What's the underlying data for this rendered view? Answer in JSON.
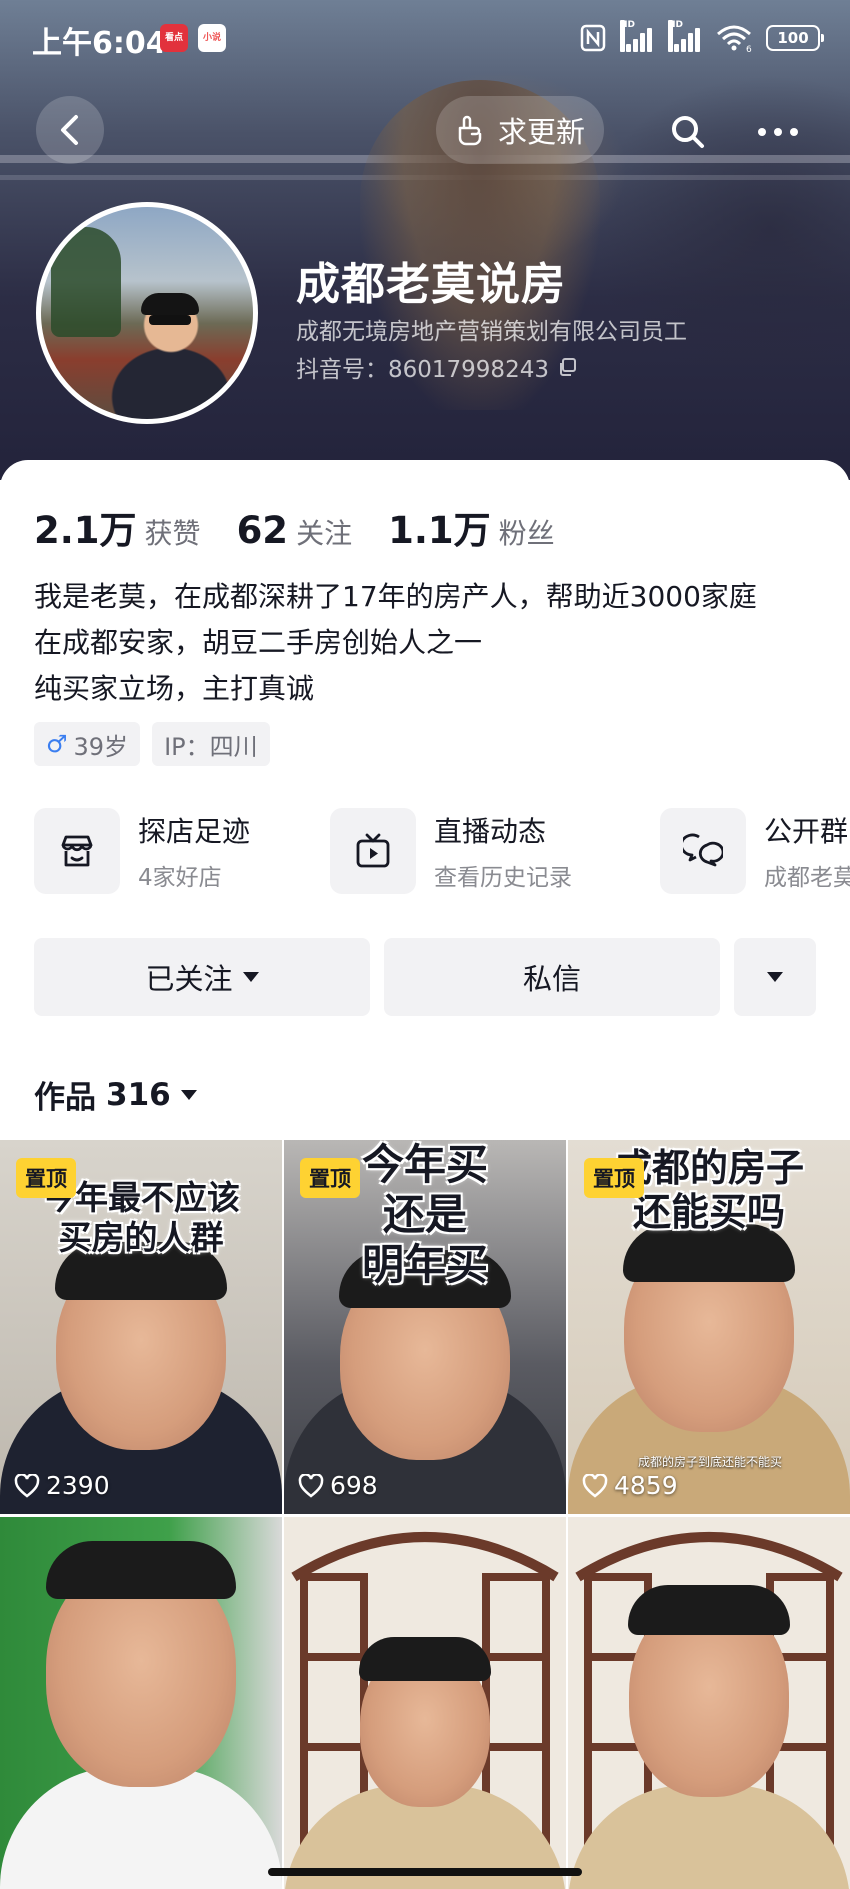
{
  "status_bar": {
    "time": "上午6:04",
    "app_badge_1": "看点",
    "app_badge_2": "小说",
    "network_1": "HD",
    "network_2": "HD",
    "wifi_label": "6",
    "battery": "100"
  },
  "nav": {
    "request_update_label": "求更新"
  },
  "profile": {
    "name": "成都老莫说房",
    "company": "成都无境房地产营销策划有限公司员工",
    "douyin_id": "抖音号：86017998243"
  },
  "stats": [
    {
      "value": "2.1万",
      "label": "获赞"
    },
    {
      "value": "62",
      "label": "关注"
    },
    {
      "value": "1.1万",
      "label": "粉丝"
    }
  ],
  "bio": {
    "line1": "我是老莫，在成都深耕了17年的房产人，帮助近3000家庭",
    "line2": "在成都安家，胡豆二手房创始人之一",
    "line3": "纯买家立场，主打真诚"
  },
  "tags": {
    "age": "39岁",
    "ip": "IP：四川"
  },
  "shortcuts": [
    {
      "title": "探店足迹",
      "subtitle": "4家好店",
      "icon": "shop-icon"
    },
    {
      "title": "直播动态",
      "subtitle": "查看历史记录",
      "icon": "tv-icon"
    },
    {
      "title": "公开群",
      "subtitle": "成都老莫",
      "icon": "chat-icon"
    }
  ],
  "actions": {
    "followed_label": "已关注",
    "message_label": "私信"
  },
  "works": {
    "label": "作品",
    "count": "316"
  },
  "videos": [
    {
      "pinned": "置顶",
      "cover_text": "今年最不应该买房的人群",
      "cover_line1": "今年最不应该",
      "cover_line2": "买房的人群",
      "likes": "2390"
    },
    {
      "pinned": "置顶",
      "cover_line1": "今年买",
      "cover_line2": "还是",
      "cover_line3": "明年买",
      "likes": "698"
    },
    {
      "pinned": "置顶",
      "cover_line1": "成都的房子",
      "cover_line2": "还能买吗",
      "caption": "成都的房子到底还能不能买",
      "likes": "4859"
    },
    {
      "likes": ""
    },
    {
      "likes": ""
    },
    {
      "likes": ""
    }
  ],
  "colors": {
    "pin_badge": "#fed232",
    "text_primary": "#161823",
    "text_secondary": "#6f7079",
    "button_bg": "#f2f2f4",
    "male_icon": "#3b7ef0"
  }
}
